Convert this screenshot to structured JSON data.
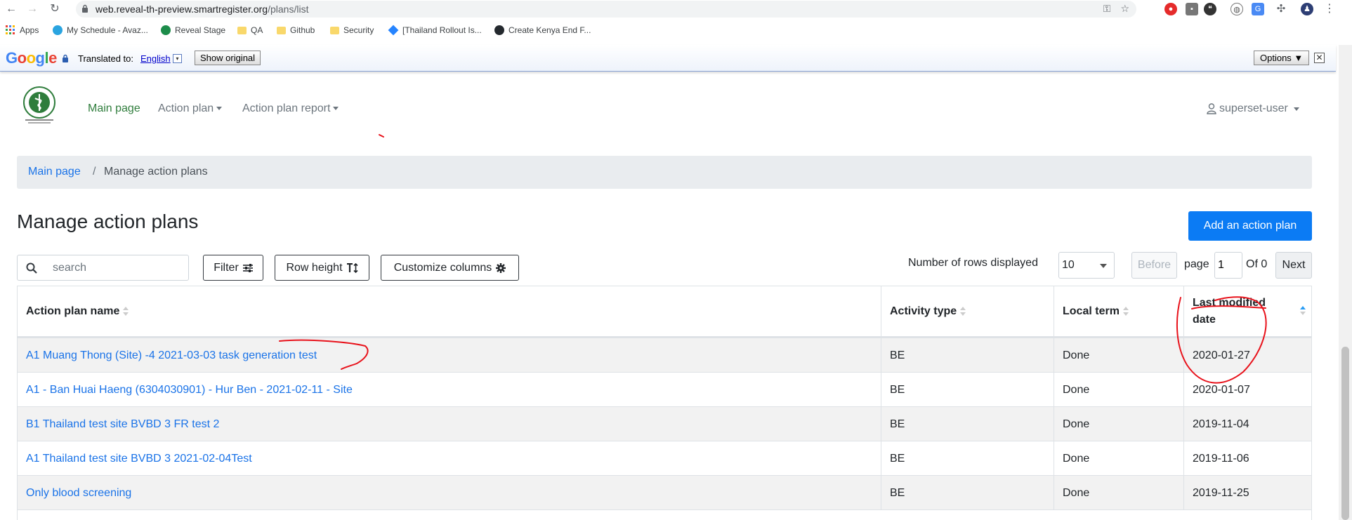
{
  "browser": {
    "url_host": "web.reveal-th-preview.smartregister.org",
    "url_path": "/plans/list",
    "bookmarks": [
      "Apps",
      "My Schedule - Avaz...",
      "Reveal Stage",
      "QA",
      "Github",
      "Security",
      "[Thailand Rollout Is...",
      "Create Kenya End F..."
    ]
  },
  "translate_bar": {
    "logo": "Google",
    "translated_to": "Translated to:",
    "language": "English",
    "show_original": "Show original",
    "options": "Options ▼",
    "close": "✕"
  },
  "nav": {
    "main_page": "Main page",
    "action_plan": "Action plan",
    "action_plan_report": "Action plan report",
    "user": "superset-user"
  },
  "breadcrumb": {
    "home": "Main page",
    "separator": "/",
    "current": "Manage action plans"
  },
  "page": {
    "title": "Manage action plans",
    "add_button": "Add an action plan"
  },
  "toolbar": {
    "search_placeholder": "search",
    "filter": "Filter",
    "row_height": "Row height",
    "customize_columns": "Customize columns",
    "rows_label": "Number of rows displayed",
    "rows_value": "10",
    "before": "Before",
    "page_label": "page",
    "page_value": "1",
    "of_label": "Of 0",
    "next": "Next"
  },
  "table": {
    "headers": [
      "Action plan name",
      "Activity type",
      "Local term",
      "Last modified date"
    ],
    "rows": [
      [
        "A1 Muang Thong (Site) -4 2021-03-03 task generation test",
        "BE",
        "Done",
        "2020-01-27"
      ],
      [
        "A1 - Ban Huai Haeng (6304030901) - Hur Ben - 2021-02-11 - Site",
        "BE",
        "Done",
        "2020-01-07"
      ],
      [
        "B1 Thailand test site BVBD 3 FR test 2",
        "BE",
        "Done",
        "2019-11-04"
      ],
      [
        "A1 Thailand test site BVBD 3 2021-02-04Test",
        "BE",
        "Done",
        "2019-11-06"
      ],
      [
        "Only blood screening",
        "BE",
        "Done",
        "2019-11-25"
      ]
    ]
  },
  "colors": {
    "link": "#1a73e8",
    "primary_button": "#0b7bf4",
    "nav_active": "#2f7d3c",
    "annotation": "#e8121b"
  }
}
